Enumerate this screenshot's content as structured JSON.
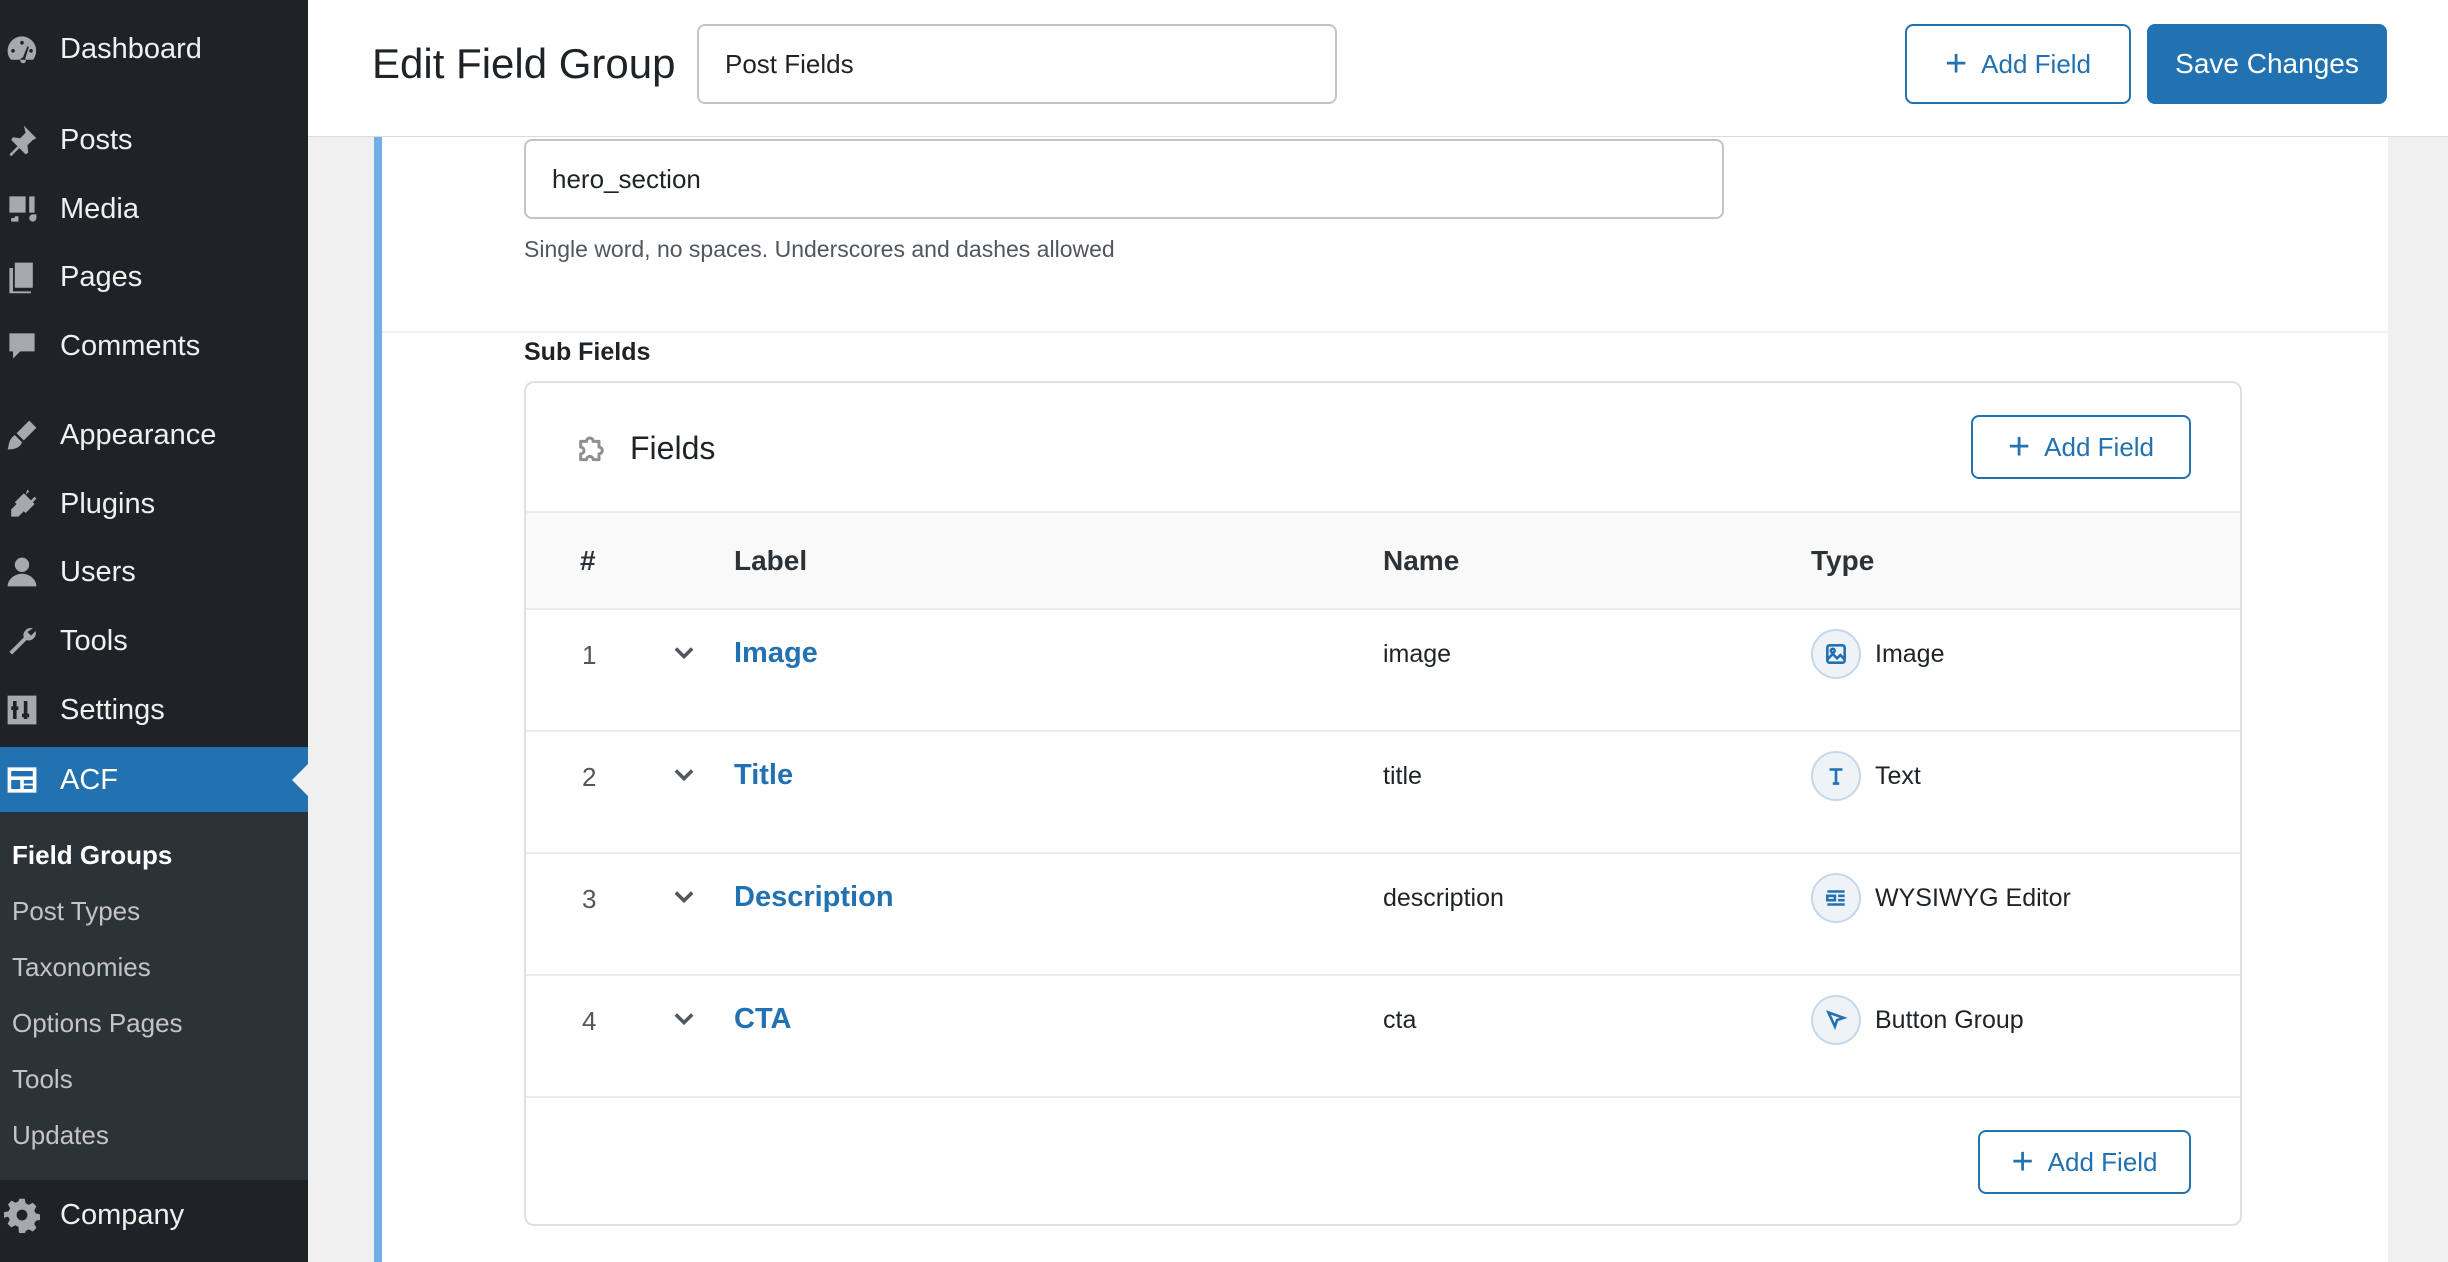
{
  "sidebar": {
    "items": [
      {
        "label": "Dashboard",
        "icon": "dashboard-icon"
      },
      {
        "label": "Posts",
        "icon": "pin-icon"
      },
      {
        "label": "Media",
        "icon": "media-icon"
      },
      {
        "label": "Pages",
        "icon": "pages-icon"
      },
      {
        "label": "Comments",
        "icon": "comment-icon"
      },
      {
        "label": "Appearance",
        "icon": "brush-icon"
      },
      {
        "label": "Plugins",
        "icon": "plug-icon"
      },
      {
        "label": "Users",
        "icon": "user-icon"
      },
      {
        "label": "Tools",
        "icon": "wrench-icon"
      },
      {
        "label": "Settings",
        "icon": "sliders-icon"
      },
      {
        "label": "ACF",
        "icon": "acf-icon"
      },
      {
        "label": "Company",
        "icon": "gear-icon"
      }
    ],
    "submenu": [
      "Field Groups",
      "Post Types",
      "Taxonomies",
      "Options Pages",
      "Tools",
      "Updates"
    ]
  },
  "header": {
    "title": "Edit Field Group",
    "group_name": "Post Fields",
    "add_field_label": "Add Field",
    "save_label": "Save Changes"
  },
  "field": {
    "name_value": "hero_section",
    "helper": "Single word, no spaces. Underscores and dashes allowed",
    "subfields_label": "Sub Fields"
  },
  "subfields": {
    "title": "Fields",
    "add_field_label": "Add Field",
    "columns": {
      "num": "#",
      "label": "Label",
      "name": "Name",
      "type": "Type"
    },
    "rows": [
      {
        "num": "1",
        "label": "Image",
        "name": "image",
        "type": "Image",
        "icon": "image-icon"
      },
      {
        "num": "2",
        "label": "Title",
        "name": "title",
        "type": "Text",
        "icon": "text-icon"
      },
      {
        "num": "3",
        "label": "Description",
        "name": "description",
        "type": "WYSIWYG Editor",
        "icon": "editor-icon"
      },
      {
        "num": "4",
        "label": "CTA",
        "name": "cta",
        "type": "Button Group",
        "icon": "cursor-icon"
      }
    ]
  },
  "colors": {
    "accent": "#2271b1",
    "sidebar": "#1d2327",
    "panel_accent": "#72aee6"
  }
}
